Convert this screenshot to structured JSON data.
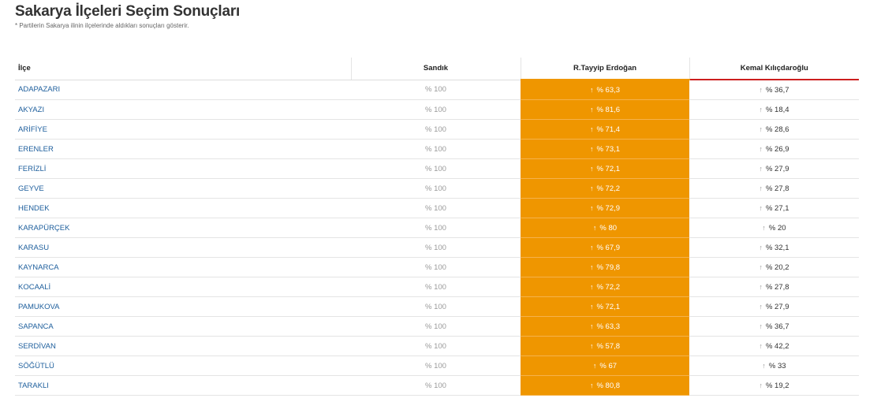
{
  "header": {
    "title": "Sakarya İlçeleri Seçim Sonuçları",
    "subtitle": "* Partilerin Sakarya ilinin ilçelerinde aldıkları sonuçları gösterir."
  },
  "table": {
    "columns": {
      "ilce": "İlçe",
      "sandik": "Sandık",
      "candidate1": "R.Tayyip Erdoğan",
      "candidate2": "Kemal Kılıçdaroğlu"
    },
    "arrow_icon": "arrow-up-icon",
    "colors": {
      "candidate1_fill": "#ef9600",
      "candidate2_accent": "#cc1f1f",
      "district_link": "#1d5e9c"
    },
    "rows": [
      {
        "district": "ADAPAZARI",
        "sandik": "% 100",
        "rte": "% 63,3",
        "kk": "% 36,7"
      },
      {
        "district": "AKYAZI",
        "sandik": "% 100",
        "rte": "% 81,6",
        "kk": "% 18,4"
      },
      {
        "district": "ARİFİYE",
        "sandik": "% 100",
        "rte": "% 71,4",
        "kk": "% 28,6"
      },
      {
        "district": "ERENLER",
        "sandik": "% 100",
        "rte": "% 73,1",
        "kk": "% 26,9"
      },
      {
        "district": "FERİZLİ",
        "sandik": "% 100",
        "rte": "% 72,1",
        "kk": "% 27,9"
      },
      {
        "district": "GEYVE",
        "sandik": "% 100",
        "rte": "% 72,2",
        "kk": "% 27,8"
      },
      {
        "district": "HENDEK",
        "sandik": "% 100",
        "rte": "% 72,9",
        "kk": "% 27,1"
      },
      {
        "district": "KARAPÜRÇEK",
        "sandik": "% 100",
        "rte": "% 80",
        "kk": "% 20"
      },
      {
        "district": "KARASU",
        "sandik": "% 100",
        "rte": "% 67,9",
        "kk": "% 32,1"
      },
      {
        "district": "KAYNARCA",
        "sandik": "% 100",
        "rte": "% 79,8",
        "kk": "% 20,2"
      },
      {
        "district": "KOCAALİ",
        "sandik": "% 100",
        "rte": "% 72,2",
        "kk": "% 27,8"
      },
      {
        "district": "PAMUKOVA",
        "sandik": "% 100",
        "rte": "% 72,1",
        "kk": "% 27,9"
      },
      {
        "district": "SAPANCA",
        "sandik": "% 100",
        "rte": "% 63,3",
        "kk": "% 36,7"
      },
      {
        "district": "SERDİVAN",
        "sandik": "% 100",
        "rte": "% 57,8",
        "kk": "% 42,2"
      },
      {
        "district": "SÖĞÜTLÜ",
        "sandik": "% 100",
        "rte": "% 67",
        "kk": "% 33"
      },
      {
        "district": "TARAKLI",
        "sandik": "% 100",
        "rte": "% 80,8",
        "kk": "% 19,2"
      }
    ]
  }
}
